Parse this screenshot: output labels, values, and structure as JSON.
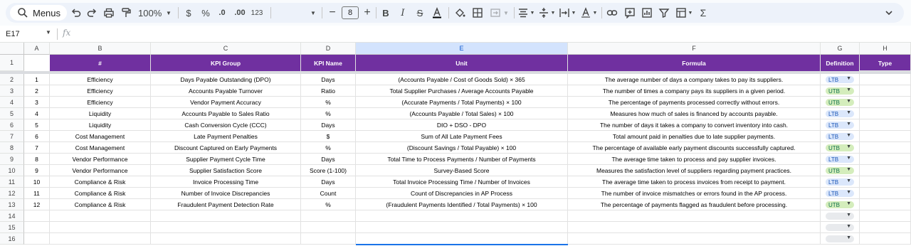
{
  "toolbar": {
    "menus_label": "Menus",
    "zoom": "100%",
    "currency": "$",
    "percent": "%",
    "dec_decrease": ".0",
    "dec_increase": ".00",
    "number_format": "123",
    "font_size": "8"
  },
  "formula_bar": {
    "cell_ref": "E17"
  },
  "columns": [
    "A",
    "B",
    "C",
    "D",
    "E",
    "F",
    "G",
    "H"
  ],
  "selected_column": "E",
  "header": [
    "#",
    "KPI Group",
    "KPI Name",
    "Unit",
    "Formula",
    "Definition",
    "Type"
  ],
  "rows": [
    {
      "num": "1",
      "group": "Efficiency",
      "name": "Days Payable Outstanding (DPO)",
      "unit": "Days",
      "formula": "(Accounts Payable / Cost of Goods Sold) × 365",
      "definition": "The average number of days a company takes to pay its suppliers.",
      "type": "LTB"
    },
    {
      "num": "2",
      "group": "Efficiency",
      "name": "Accounts Payable Turnover",
      "unit": "Ratio",
      "formula": "Total Supplier Purchases / Average Accounts Payable",
      "definition": "The number of times a company pays its suppliers in a given period.",
      "type": "UTB"
    },
    {
      "num": "3",
      "group": "Efficiency",
      "name": "Vendor Payment Accuracy",
      "unit": "%",
      "formula": "(Accurate Payments / Total Payments) × 100",
      "definition": "The percentage of payments processed correctly without errors.",
      "type": "UTB"
    },
    {
      "num": "4",
      "group": "Liquidity",
      "name": "Accounts Payable to Sales Ratio",
      "unit": "%",
      "formula": "(Accounts Payable / Total Sales) × 100",
      "definition": "Measures how much of sales is financed by accounts payable.",
      "type": "LTB"
    },
    {
      "num": "5",
      "group": "Liquidity",
      "name": "Cash Conversion Cycle (CCC)",
      "unit": "Days",
      "formula": "DIO + DSO - DPO",
      "definition": "The number of days it takes a company to convert inventory into cash.",
      "type": "LTB"
    },
    {
      "num": "6",
      "group": "Cost Management",
      "name": "Late Payment Penalties",
      "unit": "$",
      "formula": "Sum of All Late Payment Fees",
      "definition": "Total amount paid in penalties due to late supplier payments.",
      "type": "LTB"
    },
    {
      "num": "7",
      "group": "Cost Management",
      "name": "Discount Captured on Early Payments",
      "unit": "%",
      "formula": "(Discount Savings / Total Payable) × 100",
      "definition": "The percentage of available early payment discounts successfully captured.",
      "type": "UTB"
    },
    {
      "num": "8",
      "group": "Vendor Performance",
      "name": "Supplier Payment Cycle Time",
      "unit": "Days",
      "formula": "Total Time to Process Payments / Number of Payments",
      "definition": "The average time taken to process and pay supplier invoices.",
      "type": "LTB"
    },
    {
      "num": "9",
      "group": "Vendor Performance",
      "name": "Supplier Satisfaction Score",
      "unit": "Score (1-100)",
      "formula": "Survey-Based Score",
      "definition": "Measures the satisfaction level of suppliers regarding payment practices.",
      "type": "UTB"
    },
    {
      "num": "10",
      "group": "Compliance & Risk",
      "name": "Invoice Processing Time",
      "unit": "Days",
      "formula": "Total Invoice Processing Time / Number of Invoices",
      "definition": "The average time taken to process invoices from receipt to payment.",
      "type": "LTB"
    },
    {
      "num": "11",
      "group": "Compliance & Risk",
      "name": "Number of Invoice Discrepancies",
      "unit": "Count",
      "formula": "Count of Discrepancies in AP Process",
      "definition": "The number of invoice mismatches or errors found in the AP process.",
      "type": "LTB"
    },
    {
      "num": "12",
      "group": "Compliance & Risk",
      "name": "Fraudulent Payment Detection Rate",
      "unit": "%",
      "formula": "(Fraudulent Payments Identified / Total Payments) × 100",
      "definition": "The percentage of payments flagged as fraudulent before processing.",
      "type": "UTB"
    }
  ],
  "row_numbers": [
    "1",
    "2",
    "3",
    "4",
    "5",
    "6",
    "7",
    "8",
    "9",
    "10",
    "11",
    "12",
    "13",
    "14",
    "15",
    "16"
  ],
  "colors": {
    "header_bg": "#7030a0",
    "ltb_bg": "#dbe7fb",
    "utb_bg": "#d4edbc",
    "accent": "#1a73e8"
  }
}
